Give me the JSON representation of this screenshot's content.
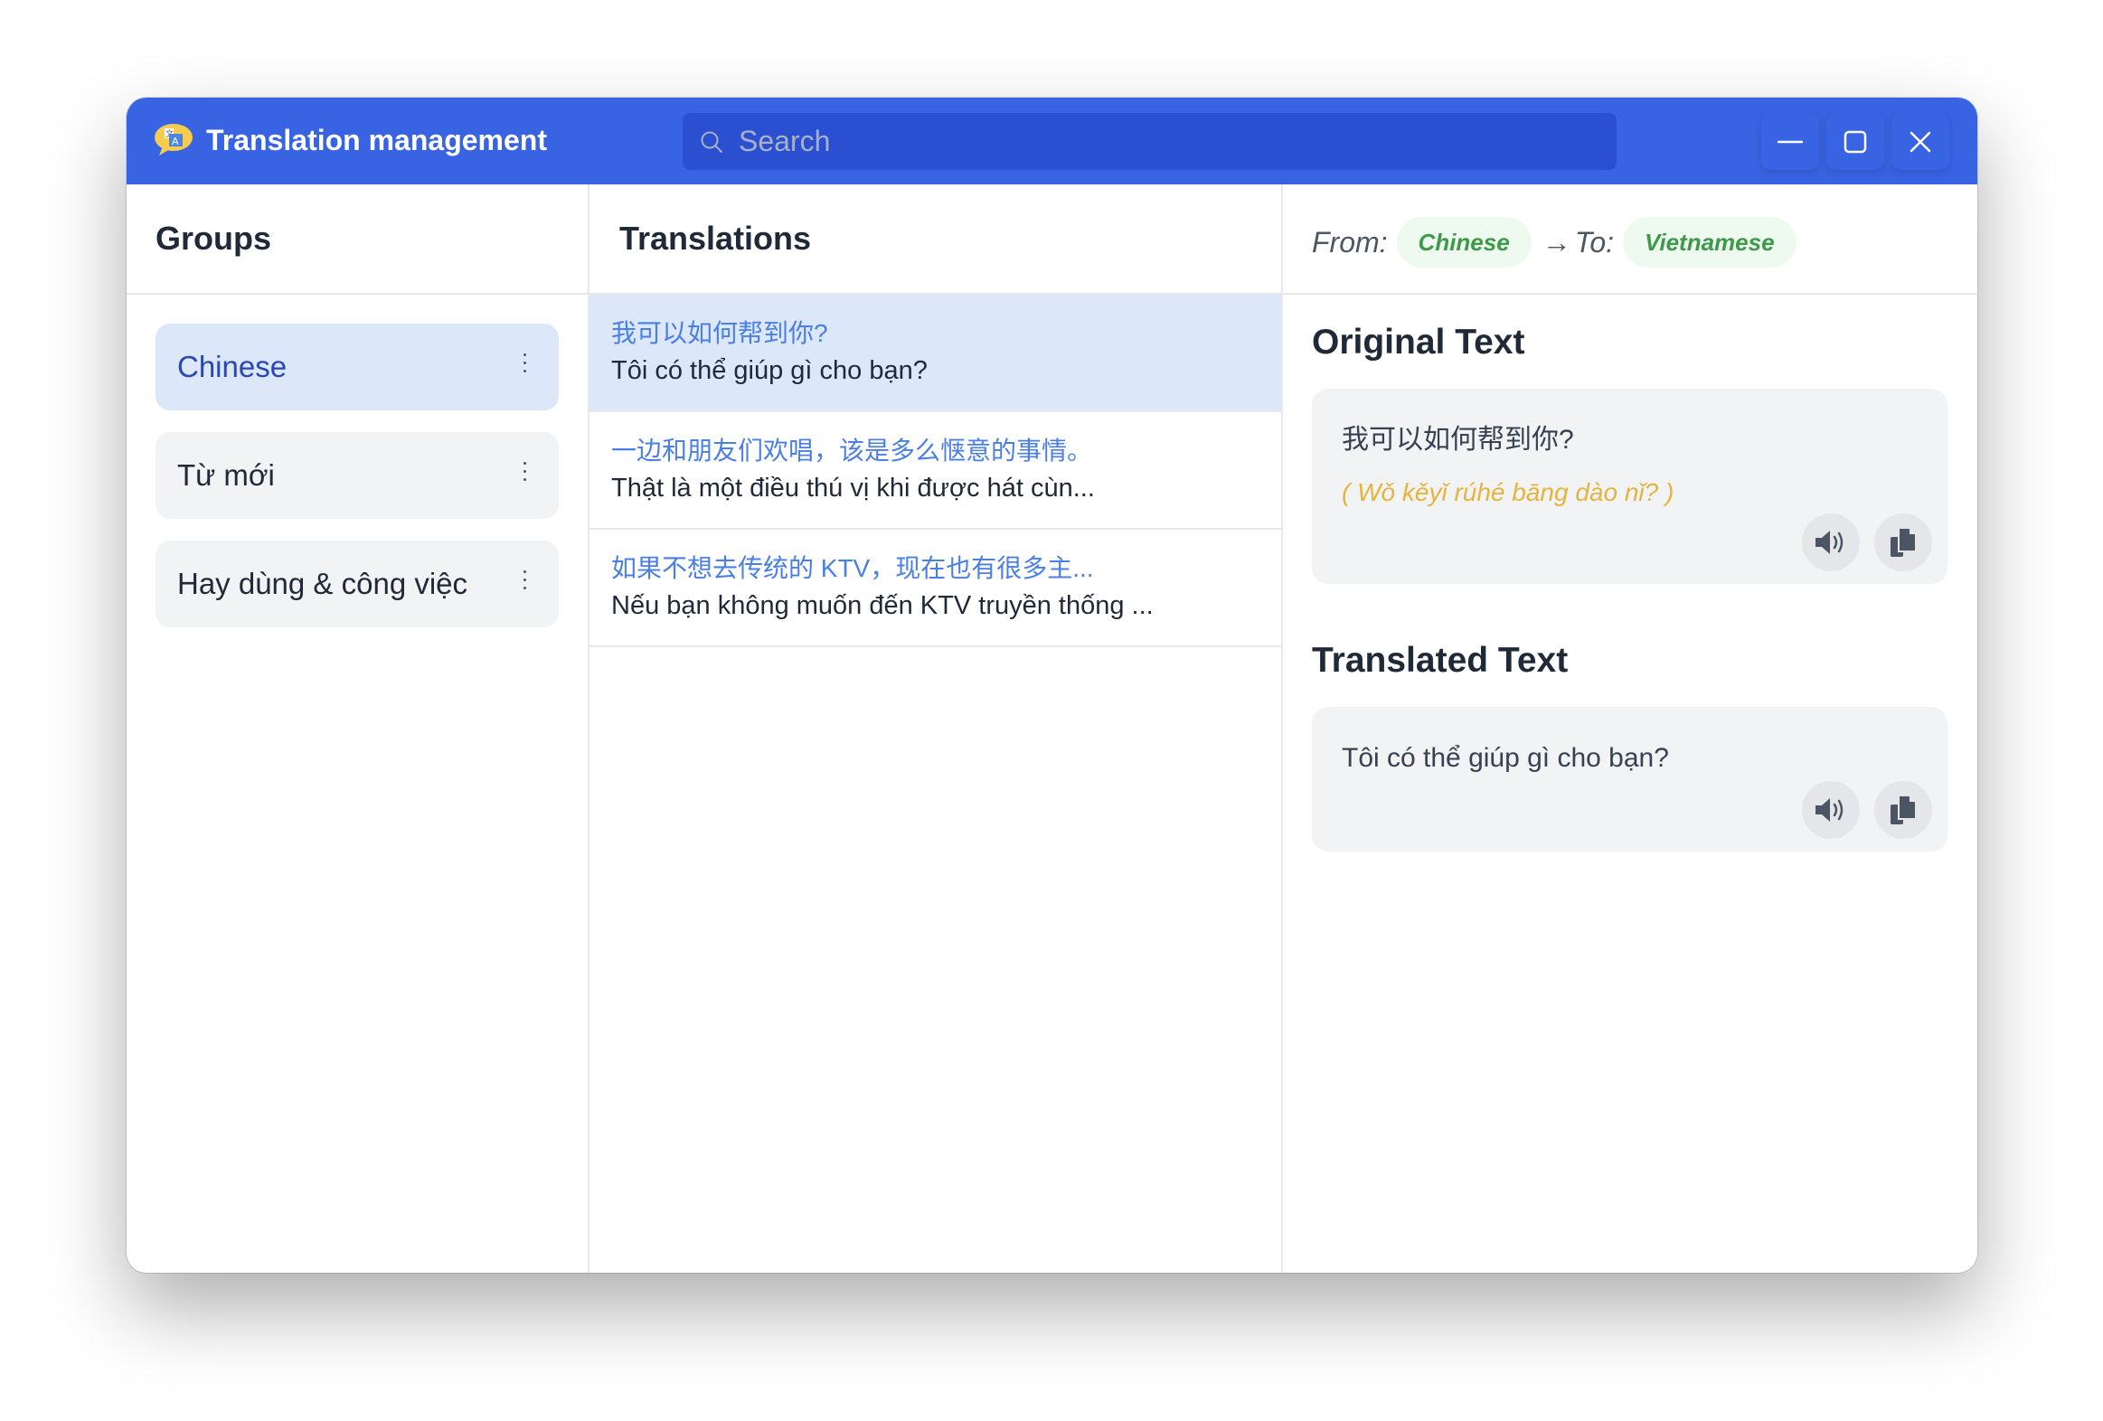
{
  "window": {
    "title": "Translation management",
    "app_icon": "translate-bubble-icon",
    "search_placeholder": "Search",
    "search_value": "",
    "controls": [
      "minimize-icon",
      "maximize-icon",
      "close-icon"
    ]
  },
  "groups": {
    "title": "Groups",
    "items": [
      {
        "label": "Chinese",
        "active": true
      },
      {
        "label": "Từ mới",
        "active": false
      },
      {
        "label": "Hay dùng & công việc",
        "active": false
      }
    ]
  },
  "translations": {
    "title": "Translations",
    "items": [
      {
        "source": "我可以如何帮到你?",
        "target": "Tôi có thể giúp gì cho bạn?",
        "active": true
      },
      {
        "source": "一边和朋友们欢唱，该是多么惬意的事情。",
        "target": "Thật là một điều thú vị khi được hát cùn...",
        "active": false
      },
      {
        "source": "如果不想去传统的 KTV，现在也有很多主...",
        "target": "Nếu bạn không muốn đến KTV truyền thống ...",
        "active": false
      }
    ]
  },
  "detail": {
    "from_label": "From:",
    "from_lang": "Chinese",
    "arrow": "→",
    "to_label": "To:",
    "to_lang": "Vietnamese",
    "original": {
      "title": "Original Text",
      "text": "我可以如何帮到你?",
      "pinyin": "( Wǒ kěyǐ rúhé bāng dào nǐ? )"
    },
    "translated": {
      "title": "Translated Text",
      "text": "Tôi có thể giúp gì cho bạn?"
    },
    "actions": [
      "speaker-icon",
      "copy-icon"
    ]
  },
  "colors": {
    "accent": "#3863e2",
    "search_bg": "#2b4fd1",
    "active_bg": "#dce7f9",
    "source_text": "#4a7fe6",
    "chip_text": "#3e9a4a",
    "pinyin": "#e7b33f"
  }
}
